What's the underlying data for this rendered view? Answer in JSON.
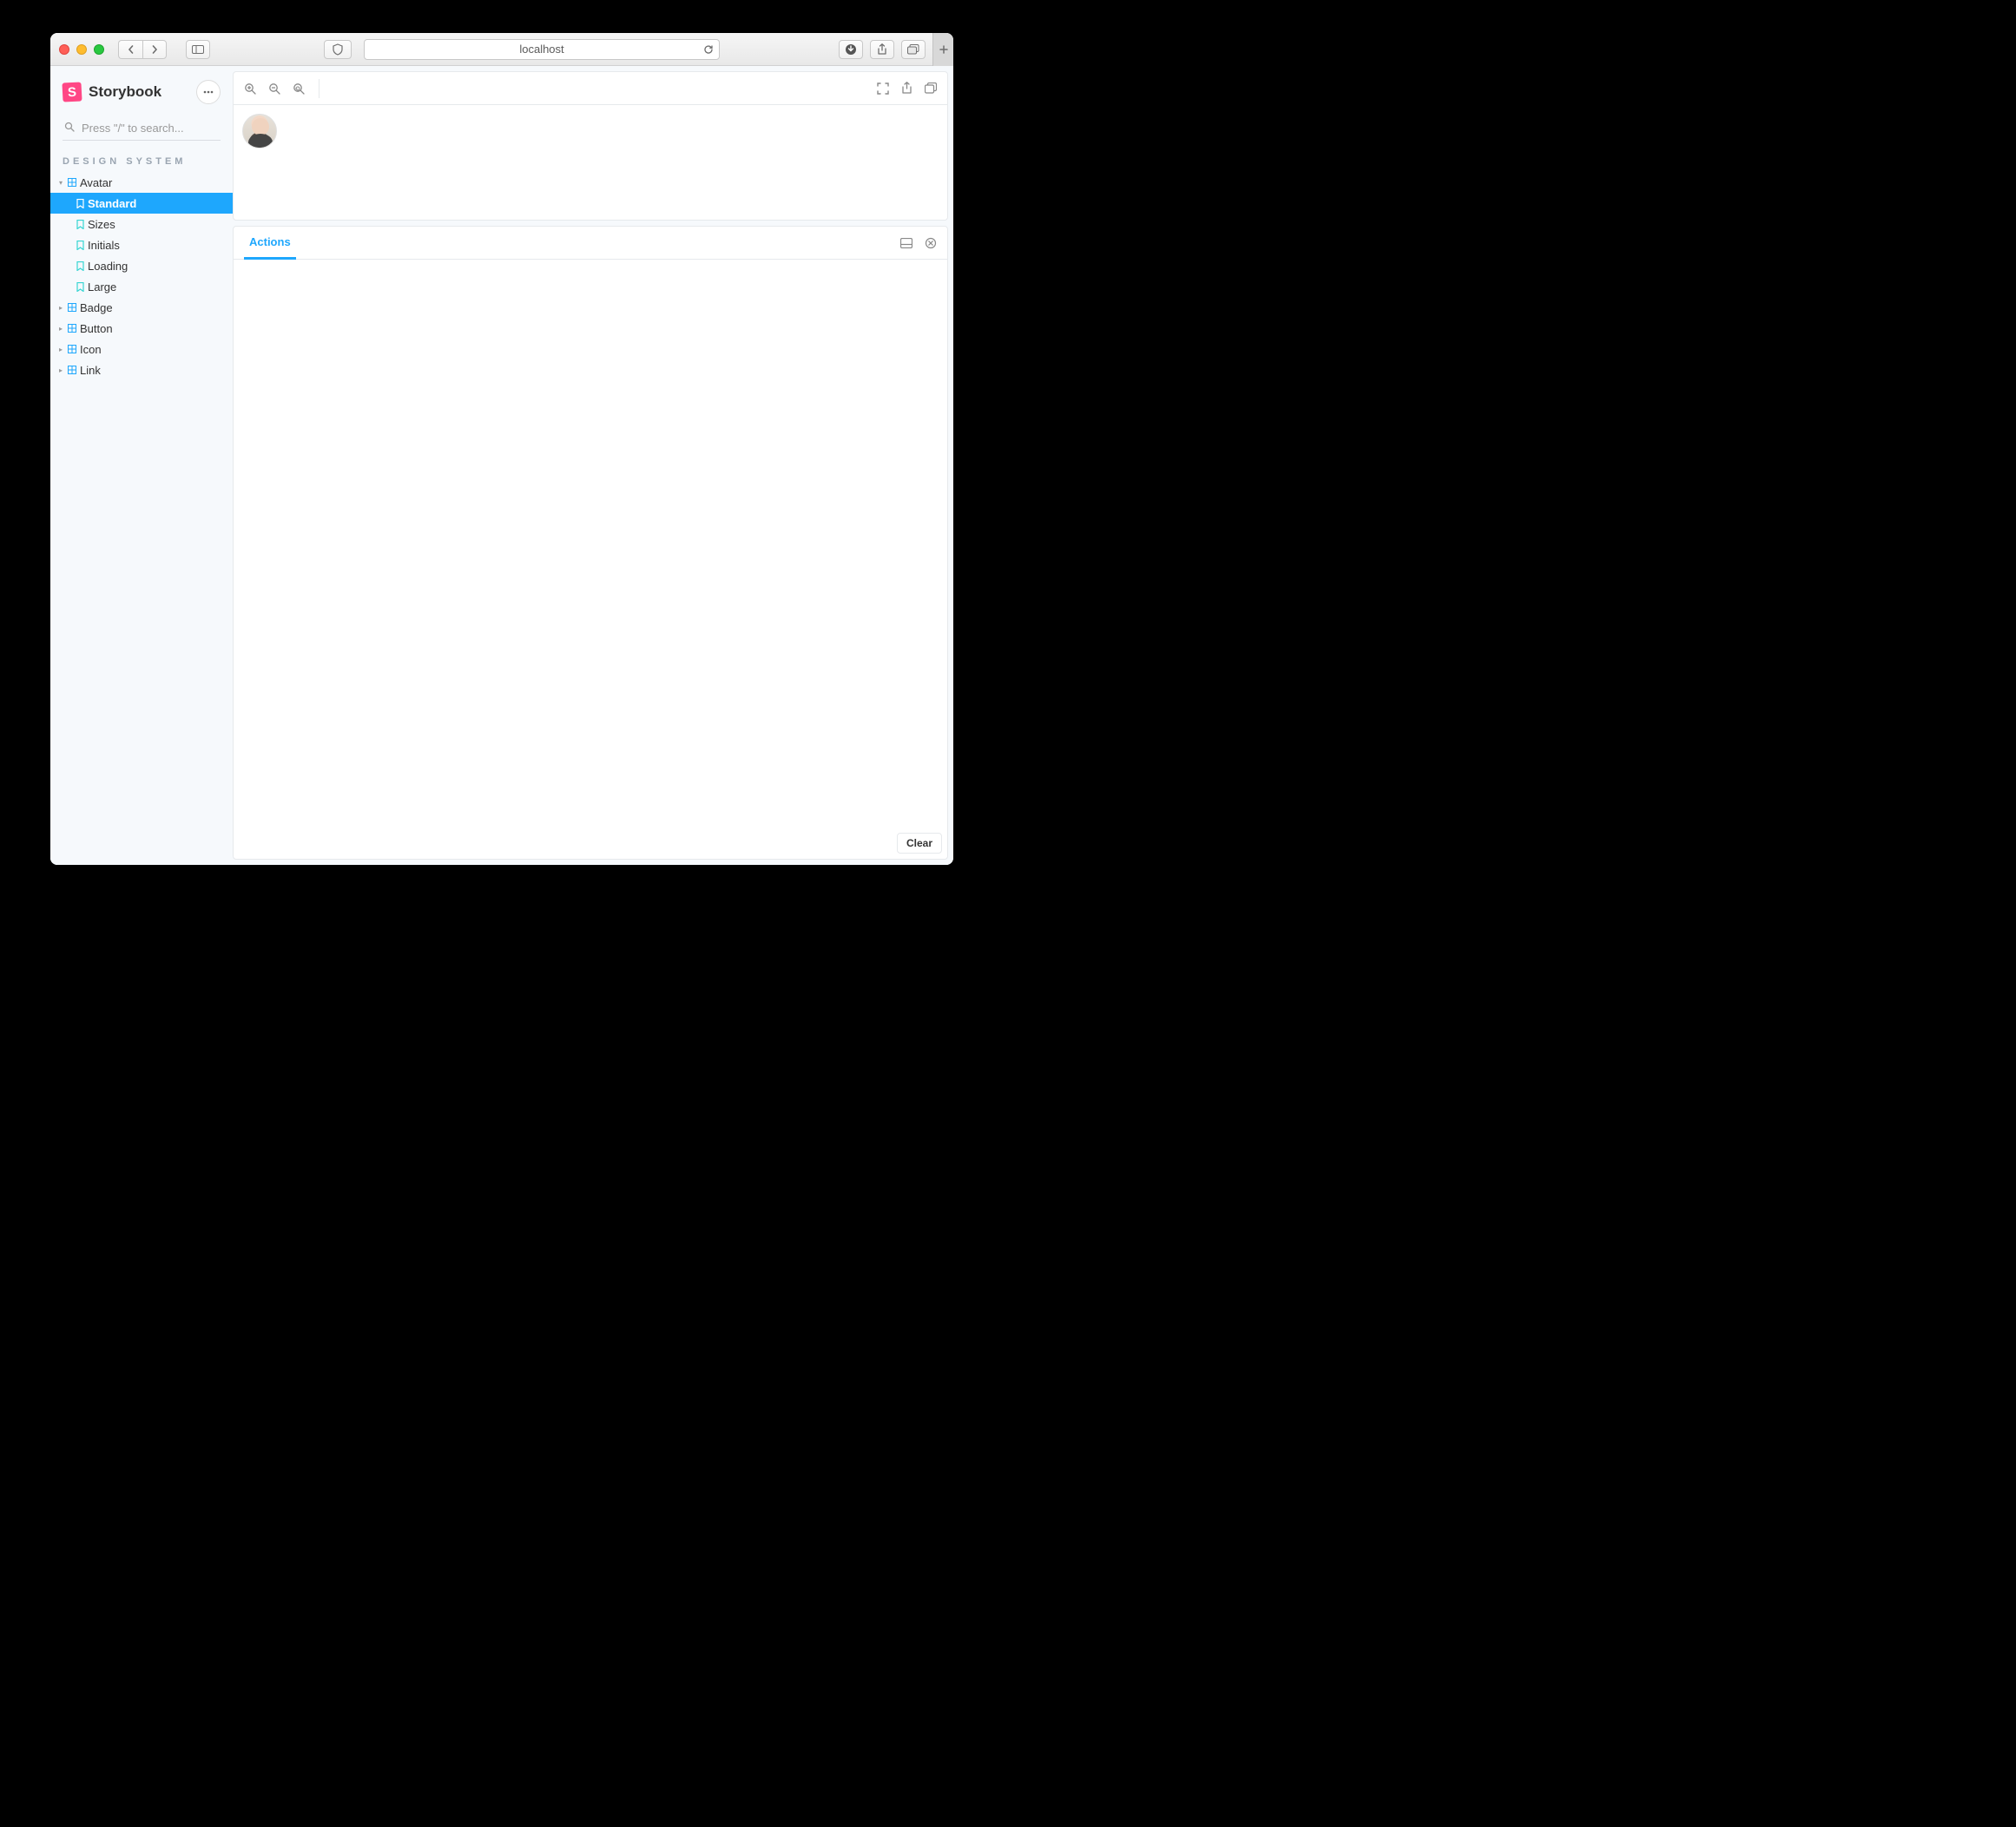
{
  "browser": {
    "address": "localhost"
  },
  "storybook": {
    "brand": "Storybook",
    "search_placeholder": "Press \"/\" to search...",
    "section_title": "DESIGN SYSTEM",
    "clear_label": "Clear",
    "tree": [
      {
        "type": "component",
        "label": "Avatar",
        "expanded": true,
        "stories": [
          {
            "label": "Standard",
            "selected": true
          },
          {
            "label": "Sizes",
            "selected": false
          },
          {
            "label": "Initials",
            "selected": false
          },
          {
            "label": "Loading",
            "selected": false
          },
          {
            "label": "Large",
            "selected": false
          }
        ]
      },
      {
        "type": "component",
        "label": "Badge",
        "expanded": false
      },
      {
        "type": "component",
        "label": "Button",
        "expanded": false
      },
      {
        "type": "component",
        "label": "Icon",
        "expanded": false
      },
      {
        "type": "component",
        "label": "Link",
        "expanded": false
      }
    ],
    "addons": {
      "active_tab": "Actions"
    }
  }
}
